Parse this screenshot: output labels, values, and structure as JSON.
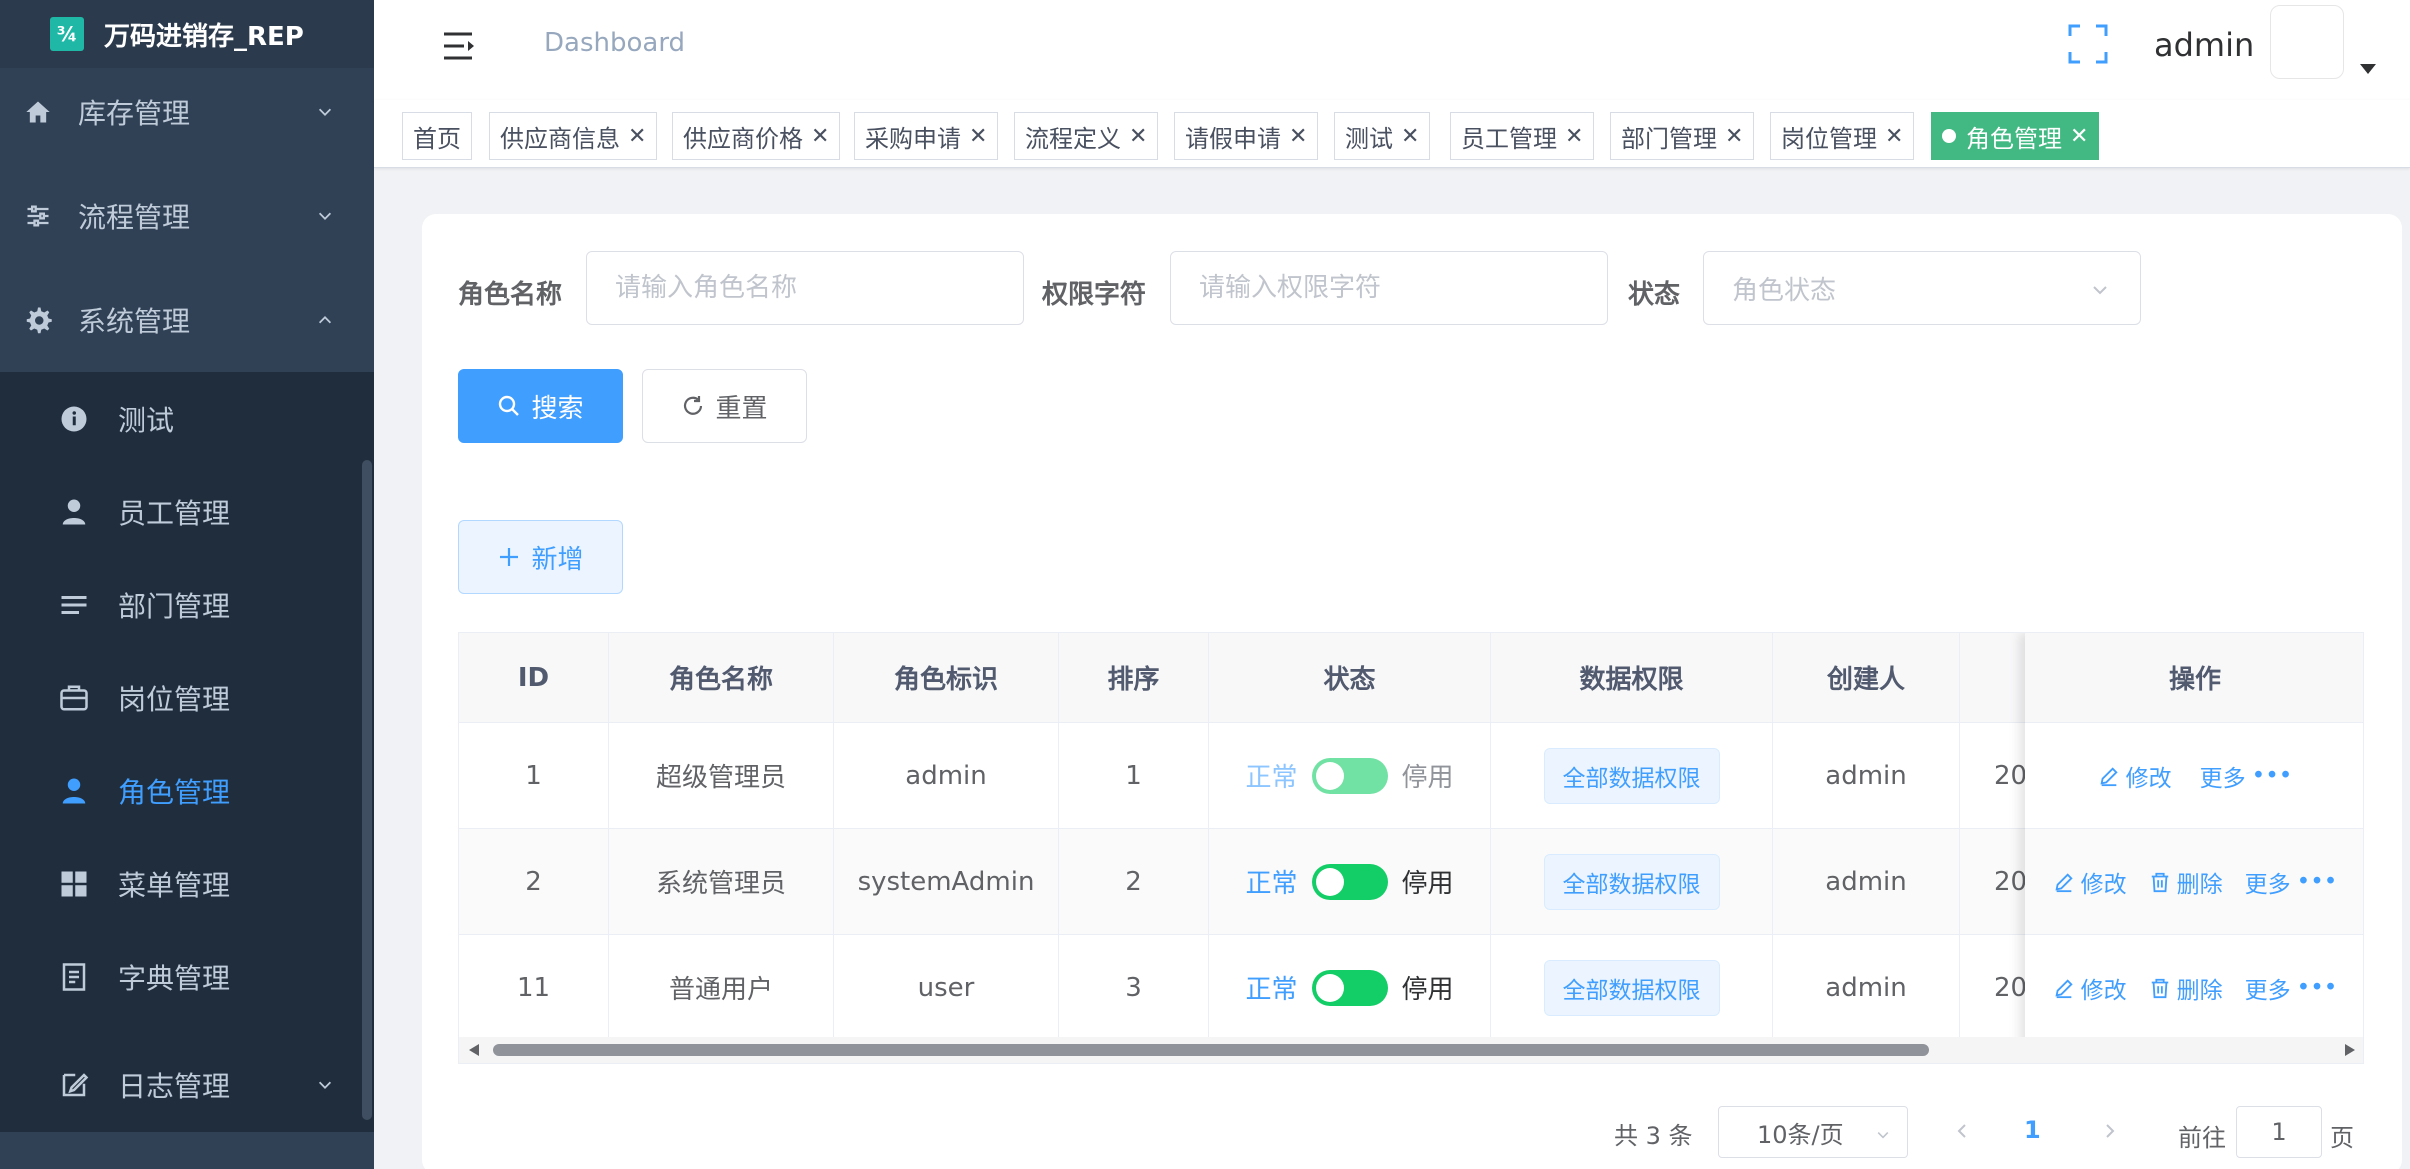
{
  "colors": {
    "sidebar_bg": "#304156",
    "submenu_bg": "#1f2d3d",
    "primary": "#409eff",
    "active_tag": "#42b983",
    "switch_on": "#13ce66"
  },
  "sidebar": {
    "logo_text": "万码进销存_REP",
    "logo_mark": "¾",
    "menus": [
      {
        "label": "库存管理",
        "icon": "home-icon"
      },
      {
        "label": "流程管理",
        "icon": "sliders-icon"
      },
      {
        "label": "系统管理",
        "icon": "gear-icon"
      }
    ],
    "submenu": [
      {
        "label": "测试",
        "icon": "info-icon"
      },
      {
        "label": "员工管理",
        "icon": "user-icon"
      },
      {
        "label": "部门管理",
        "icon": "list-icon"
      },
      {
        "label": "岗位管理",
        "icon": "briefcase-icon"
      },
      {
        "label": "角色管理",
        "icon": "user-icon",
        "active": true
      },
      {
        "label": "菜单管理",
        "icon": "grid-icon"
      },
      {
        "label": "字典管理",
        "icon": "document-icon"
      },
      {
        "label": "日志管理",
        "icon": "edit-icon"
      }
    ]
  },
  "navbar": {
    "breadcrumb": "Dashboard",
    "username": "admin"
  },
  "tags": [
    {
      "label": "首页",
      "closable": false
    },
    {
      "label": "供应商信息",
      "closable": true
    },
    {
      "label": "供应商价格",
      "closable": true
    },
    {
      "label": "采购申请",
      "closable": true
    },
    {
      "label": "流程定义",
      "closable": true
    },
    {
      "label": "请假申请",
      "closable": true
    },
    {
      "label": "测试",
      "closable": true
    },
    {
      "label": "员工管理",
      "closable": true
    },
    {
      "label": "部门管理",
      "closable": true
    },
    {
      "label": "岗位管理",
      "closable": true
    },
    {
      "label": "角色管理",
      "closable": true,
      "active": true
    }
  ],
  "search": {
    "role_name_label": "角色名称",
    "role_name_placeholder": "请输入角色名称",
    "perm_label": "权限字符",
    "perm_placeholder": "请输入权限字符",
    "status_label": "状态",
    "status_placeholder": "角色状态",
    "search_button": "搜索",
    "reset_button": "重置",
    "add_button": "新增"
  },
  "table": {
    "headers": [
      "ID",
      "角色名称",
      "角色标识",
      "排序",
      "状态",
      "数据权限",
      "创建人",
      "操作"
    ],
    "rows": [
      {
        "id": "1",
        "name": "超级管理员",
        "key": "admin",
        "sort": "1",
        "status_on": "正常",
        "status_off": "停用",
        "switch_on": true,
        "disabled": true,
        "data_scope": "全部数据权限",
        "creator": "admin",
        "created": "20",
        "ops": [
          "修改",
          "更多"
        ]
      },
      {
        "id": "2",
        "name": "系统管理员",
        "key": "systemAdmin",
        "sort": "2",
        "status_on": "正常",
        "status_off": "停用",
        "switch_on": true,
        "disabled": false,
        "data_scope": "全部数据权限",
        "creator": "admin",
        "created": "20",
        "ops": [
          "修改",
          "删除",
          "更多"
        ]
      },
      {
        "id": "11",
        "name": "普通用户",
        "key": "user",
        "sort": "3",
        "status_on": "正常",
        "status_off": "停用",
        "switch_on": true,
        "disabled": false,
        "data_scope": "全部数据权限",
        "creator": "admin",
        "created": "20",
        "ops": [
          "修改",
          "删除",
          "更多"
        ]
      }
    ]
  },
  "pagination": {
    "total_text": "共 3 条",
    "page_size": "10条/页",
    "current_page": "1",
    "goto_label": "前往",
    "goto_value": "1",
    "page_suffix": "页"
  }
}
